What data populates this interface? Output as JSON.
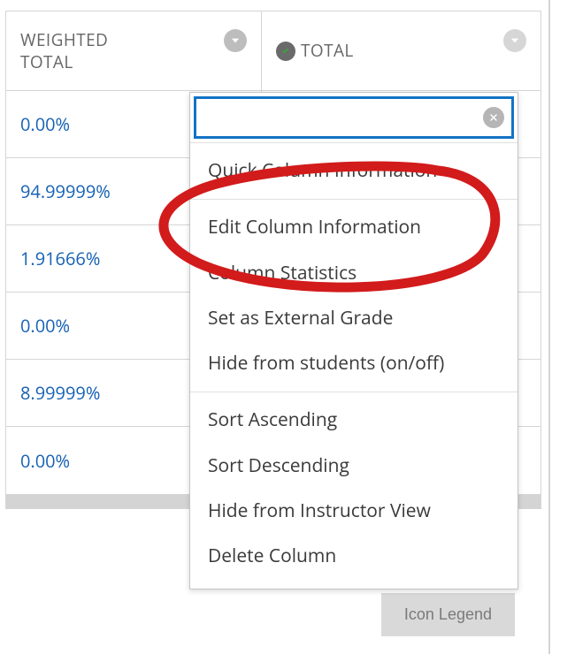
{
  "columns": {
    "col1": {
      "label": "WEIGHTED TOTAL"
    },
    "col2": {
      "label": "TOTAL"
    }
  },
  "rows": [
    {
      "weighted": "0.00%"
    },
    {
      "weighted": "94.99999%"
    },
    {
      "weighted": "1.91666%"
    },
    {
      "weighted": "0.00%"
    },
    {
      "weighted": "8.99999%"
    },
    {
      "weighted": "0.00%"
    }
  ],
  "menu": {
    "group1": [
      "Quick Column Information"
    ],
    "group2": [
      "Edit Column Information",
      "Column Statistics",
      "Set as External Grade",
      "Hide from students (on/off)"
    ],
    "group3": [
      "Sort Ascending",
      "Sort Descending",
      "Hide from Instructor View",
      "Delete Column"
    ]
  },
  "buttons": {
    "icon_legend": "Icon Legend"
  }
}
